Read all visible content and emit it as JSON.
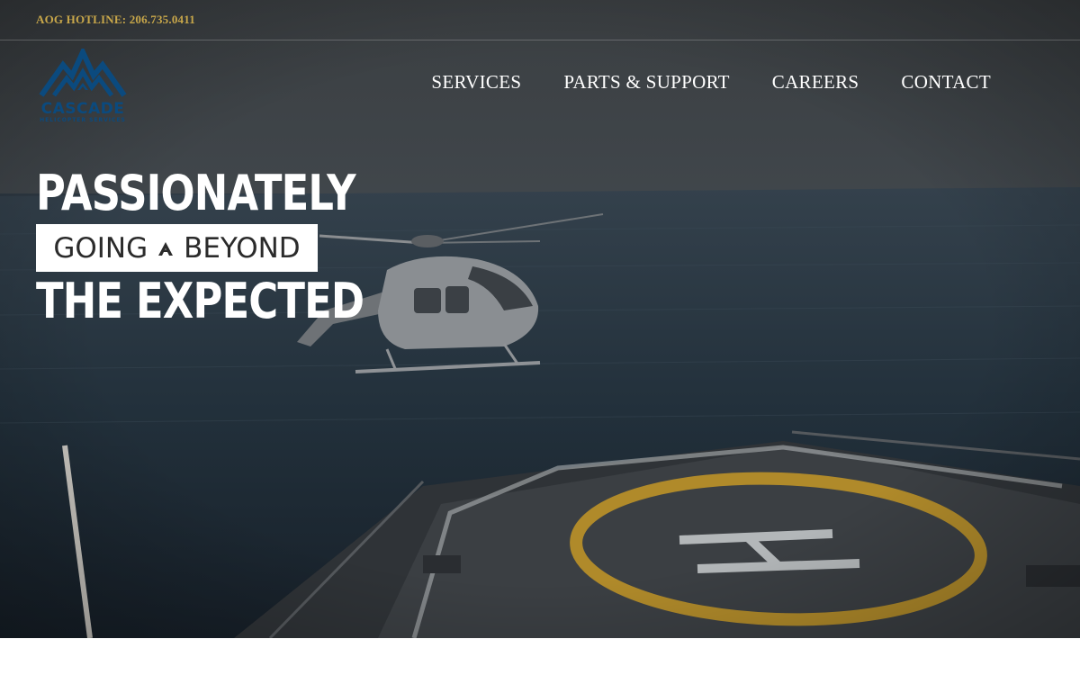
{
  "topbar": {
    "hotline": "AOG HOTLINE: 206.735.0411"
  },
  "logo": {
    "name": "CASCADE",
    "subtitle": "HELICOPTER SERVICES",
    "color": "#0b4a7e"
  },
  "nav": {
    "items": [
      {
        "label": "SERVICES"
      },
      {
        "label": "PARTS & SUPPORT"
      },
      {
        "label": "CAREERS"
      },
      {
        "label": "CONTACT"
      }
    ]
  },
  "hero": {
    "line1": "PASSIONATELY",
    "line2_left": "GOING",
    "line2_right": "BEYOND",
    "line3": "THE EXPECTED",
    "helipad_letter": "H"
  },
  "colors": {
    "hotline": "#c8a74a",
    "nav_text": "#ffffff",
    "helipad_ring": "#b08a2a"
  }
}
